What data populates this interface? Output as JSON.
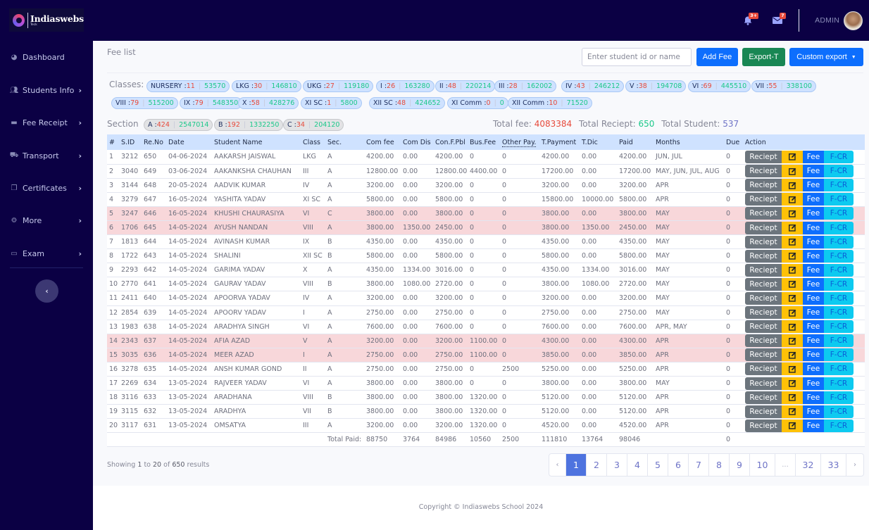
{
  "brand": {
    "name": "Indiaswebs",
    "tagline": "Teck"
  },
  "topbar": {
    "alerts_badge": "3+",
    "messages_badge": "7",
    "user_label": "ADMIN"
  },
  "sidebar": {
    "items": [
      {
        "label": "Dashboard",
        "icon": "gauge-icon",
        "has_children": false
      },
      {
        "label": "Students Info",
        "icon": "users-icon",
        "has_children": true
      },
      {
        "label": "Fee Receipt",
        "icon": "id-card-icon",
        "has_children": true
      },
      {
        "label": "Transport",
        "icon": "bus-icon",
        "has_children": true
      },
      {
        "label": "Certificates",
        "icon": "copy-icon",
        "has_children": true
      },
      {
        "label": "More",
        "icon": "gear-icon",
        "has_children": true
      },
      {
        "label": "Exam",
        "icon": "chalkboard-icon",
        "has_children": true
      }
    ]
  },
  "page": {
    "title": "Fee list",
    "search_placeholder": "Enter student id or name",
    "search_value": "",
    "buttons": {
      "add_fee": "Add Fee",
      "export_t": "Export-T",
      "custom_export": "Custom export"
    }
  },
  "classes": {
    "label": "Classes:",
    "items": [
      {
        "name": "NURSERY",
        "count": "11",
        "amount": "53570"
      },
      {
        "name": "LKG",
        "count": "30",
        "amount": "146810"
      },
      {
        "name": "UKG",
        "count": "27",
        "amount": "119180"
      },
      {
        "name": "I",
        "count": "26",
        "amount": "163280"
      },
      {
        "name": "II",
        "count": "48",
        "amount": "220214"
      },
      {
        "name": "III",
        "count": "28",
        "amount": "162002"
      },
      {
        "name": "IV",
        "count": "43",
        "amount": "246212"
      },
      {
        "name": "V",
        "count": "38",
        "amount": "194708"
      },
      {
        "name": "VI",
        "count": "69",
        "amount": "445510"
      },
      {
        "name": "VII",
        "count": "55",
        "amount": "338100"
      },
      {
        "name": "VIII",
        "count": "79",
        "amount": "515200"
      },
      {
        "name": "IX",
        "count": "79",
        "amount": "548350"
      },
      {
        "name": "X",
        "count": "58",
        "amount": "428276"
      },
      {
        "name": "XI SC",
        "count": "1",
        "amount": "5800"
      },
      {
        "name": "XII SC",
        "count": "48",
        "amount": "424652"
      },
      {
        "name": "XI Comm",
        "count": "0",
        "amount": "0"
      },
      {
        "name": "XII Comm",
        "count": "10",
        "amount": "71520"
      }
    ]
  },
  "sections": {
    "label": "Section",
    "items": [
      {
        "name": "A",
        "count": "424",
        "amount": "2547014"
      },
      {
        "name": "B",
        "count": "192",
        "amount": "1332250"
      },
      {
        "name": "C",
        "count": "34",
        "amount": "204120"
      }
    ]
  },
  "totals": {
    "fee_label": "Total fee:",
    "fee_value": "4083384",
    "receipt_label": "Total Reciept:",
    "receipt_value": "650",
    "student_label": "Total Student:",
    "student_value": "537"
  },
  "table": {
    "columns": [
      "#",
      "S.ID",
      "Re.No",
      "Date",
      "Student Name",
      "Class",
      "Sec.",
      "Com fee",
      "Com Dis",
      "Con.F.Pbl",
      "Bus.Fee",
      "Other Pay.",
      "T.Payment",
      "T.Dic",
      "Paid",
      "Months",
      "Due",
      "Action"
    ],
    "action_labels": {
      "receipt": "Reciept",
      "edit": "edit-icon",
      "fee": "Fee",
      "fcr": "F-CR"
    },
    "rows": [
      {
        "n": "1",
        "sid": "3212",
        "reno": "650",
        "date": "04-06-2024",
        "name": "AAKARSH JAISWAL",
        "cls": "LKG",
        "sec": "A",
        "comfee": "4200.00",
        "comdis": "0.00",
        "conf": "4200.00",
        "bus": "0",
        "other": "0",
        "tpay": "4200.00",
        "tdic": "0.00",
        "paid": "4200.00",
        "months": "JUN, JUL",
        "due": "0",
        "highlight": false
      },
      {
        "n": "2",
        "sid": "3040",
        "reno": "649",
        "date": "03-06-2024",
        "name": "AAKANKSHA CHAUHAN",
        "cls": "III",
        "sec": "A",
        "comfee": "12800.00",
        "comdis": "0.00",
        "conf": "12800.00",
        "bus": "4400.00",
        "other": "0",
        "tpay": "17200.00",
        "tdic": "0.00",
        "paid": "17200.00",
        "months": "MAY, JUN, JUL, AUG",
        "due": "0",
        "highlight": false
      },
      {
        "n": "3",
        "sid": "3144",
        "reno": "648",
        "date": "20-05-2024",
        "name": "AADVIK KUMAR",
        "cls": "IV",
        "sec": "A",
        "comfee": "3200.00",
        "comdis": "0.00",
        "conf": "3200.00",
        "bus": "0",
        "other": "0",
        "tpay": "3200.00",
        "tdic": "0.00",
        "paid": "3200.00",
        "months": "APR",
        "due": "0",
        "highlight": false
      },
      {
        "n": "4",
        "sid": "3279",
        "reno": "647",
        "date": "16-05-2024",
        "name": "YASHITA YADAV",
        "cls": "XI SC",
        "sec": "A",
        "comfee": "5800.00",
        "comdis": "0.00",
        "conf": "5800.00",
        "bus": "0",
        "other": "0",
        "tpay": "15800.00",
        "tdic": "10000.00",
        "paid": "5800.00",
        "months": "APR",
        "due": "0",
        "highlight": false
      },
      {
        "n": "5",
        "sid": "3247",
        "reno": "646",
        "date": "16-05-2024",
        "name": "KHUSHI CHAURASIYA",
        "cls": "VI",
        "sec": "C",
        "comfee": "3800.00",
        "comdis": "0.00",
        "conf": "3800.00",
        "bus": "0",
        "other": "0",
        "tpay": "3800.00",
        "tdic": "0.00",
        "paid": "3800.00",
        "months": "MAY",
        "due": "0",
        "highlight": true
      },
      {
        "n": "6",
        "sid": "1706",
        "reno": "645",
        "date": "14-05-2024",
        "name": "AYUSH NANDAN",
        "cls": "VIII",
        "sec": "A",
        "comfee": "3800.00",
        "comdis": "1350.00",
        "conf": "2450.00",
        "bus": "0",
        "other": "0",
        "tpay": "3800.00",
        "tdic": "1350.00",
        "paid": "2450.00",
        "months": "MAY",
        "due": "0",
        "highlight": true
      },
      {
        "n": "7",
        "sid": "1813",
        "reno": "644",
        "date": "14-05-2024",
        "name": "AVINASH KUMAR",
        "cls": "IX",
        "sec": "B",
        "comfee": "4350.00",
        "comdis": "0.00",
        "conf": "4350.00",
        "bus": "0",
        "other": "0",
        "tpay": "4350.00",
        "tdic": "0.00",
        "paid": "4350.00",
        "months": "MAY",
        "due": "0",
        "highlight": false
      },
      {
        "n": "8",
        "sid": "1722",
        "reno": "643",
        "date": "14-05-2024",
        "name": "SHALINI",
        "cls": "XII SC",
        "sec": "B",
        "comfee": "5800.00",
        "comdis": "0.00",
        "conf": "5800.00",
        "bus": "0",
        "other": "0",
        "tpay": "5800.00",
        "tdic": "0.00",
        "paid": "5800.00",
        "months": "MAY",
        "due": "0",
        "highlight": false
      },
      {
        "n": "9",
        "sid": "2293",
        "reno": "642",
        "date": "14-05-2024",
        "name": "GARIMA YADAV",
        "cls": "X",
        "sec": "A",
        "comfee": "4350.00",
        "comdis": "1334.00",
        "conf": "3016.00",
        "bus": "0",
        "other": "0",
        "tpay": "4350.00",
        "tdic": "1334.00",
        "paid": "3016.00",
        "months": "MAY",
        "due": "0",
        "highlight": false
      },
      {
        "n": "10",
        "sid": "2770",
        "reno": "641",
        "date": "14-05-2024",
        "name": "GAURAV YADAV",
        "cls": "VIII",
        "sec": "B",
        "comfee": "3800.00",
        "comdis": "1080.00",
        "conf": "2720.00",
        "bus": "0",
        "other": "0",
        "tpay": "3800.00",
        "tdic": "1080.00",
        "paid": "2720.00",
        "months": "MAY",
        "due": "0",
        "highlight": false
      },
      {
        "n": "11",
        "sid": "2411",
        "reno": "640",
        "date": "14-05-2024",
        "name": "APOORVA YADAV",
        "cls": "IV",
        "sec": "A",
        "comfee": "3200.00",
        "comdis": "0.00",
        "conf": "3200.00",
        "bus": "0",
        "other": "0",
        "tpay": "3200.00",
        "tdic": "0.00",
        "paid": "3200.00",
        "months": "MAY",
        "due": "0",
        "highlight": false
      },
      {
        "n": "12",
        "sid": "2854",
        "reno": "639",
        "date": "14-05-2024",
        "name": "APOORV YADAV",
        "cls": "I",
        "sec": "A",
        "comfee": "2750.00",
        "comdis": "0.00",
        "conf": "2750.00",
        "bus": "0",
        "other": "0",
        "tpay": "2750.00",
        "tdic": "0.00",
        "paid": "2750.00",
        "months": "MAY",
        "due": "0",
        "highlight": false
      },
      {
        "n": "13",
        "sid": "1983",
        "reno": "638",
        "date": "14-05-2024",
        "name": "ARADHYA SINGH",
        "cls": "VI",
        "sec": "A",
        "comfee": "7600.00",
        "comdis": "0.00",
        "conf": "7600.00",
        "bus": "0",
        "other": "0",
        "tpay": "7600.00",
        "tdic": "0.00",
        "paid": "7600.00",
        "months": "APR, MAY",
        "due": "0",
        "highlight": false
      },
      {
        "n": "14",
        "sid": "2343",
        "reno": "637",
        "date": "14-05-2024",
        "name": "AFIA AZAD",
        "cls": "V",
        "sec": "A",
        "comfee": "3200.00",
        "comdis": "0.00",
        "conf": "3200.00",
        "bus": "1100.00",
        "other": "0",
        "tpay": "4300.00",
        "tdic": "0.00",
        "paid": "4300.00",
        "months": "APR",
        "due": "0",
        "highlight": true
      },
      {
        "n": "15",
        "sid": "3035",
        "reno": "636",
        "date": "14-05-2024",
        "name": "MEER AZAD",
        "cls": "I",
        "sec": "A",
        "comfee": "2750.00",
        "comdis": "0.00",
        "conf": "2750.00",
        "bus": "1100.00",
        "other": "0",
        "tpay": "3850.00",
        "tdic": "0.00",
        "paid": "3850.00",
        "months": "APR",
        "due": "0",
        "highlight": true
      },
      {
        "n": "16",
        "sid": "3278",
        "reno": "635",
        "date": "14-05-2024",
        "name": "ANSH KUMAR GOND",
        "cls": "II",
        "sec": "A",
        "comfee": "2750.00",
        "comdis": "0.00",
        "conf": "2750.00",
        "bus": "0",
        "other": "2500",
        "tpay": "5250.00",
        "tdic": "0.00",
        "paid": "5250.00",
        "months": "APR",
        "due": "0",
        "highlight": false
      },
      {
        "n": "17",
        "sid": "2269",
        "reno": "634",
        "date": "13-05-2024",
        "name": "RAJVEER YADAV",
        "cls": "VI",
        "sec": "A",
        "comfee": "3800.00",
        "comdis": "0.00",
        "conf": "3800.00",
        "bus": "0",
        "other": "0",
        "tpay": "3800.00",
        "tdic": "0.00",
        "paid": "3800.00",
        "months": "MAY",
        "due": "0",
        "highlight": false
      },
      {
        "n": "18",
        "sid": "3116",
        "reno": "633",
        "date": "13-05-2024",
        "name": "ARADHANA",
        "cls": "VIII",
        "sec": "B",
        "comfee": "3800.00",
        "comdis": "0.00",
        "conf": "3800.00",
        "bus": "1320.00",
        "other": "0",
        "tpay": "5120.00",
        "tdic": "0.00",
        "paid": "5120.00",
        "months": "APR",
        "due": "0",
        "highlight": false
      },
      {
        "n": "19",
        "sid": "3115",
        "reno": "632",
        "date": "13-05-2024",
        "name": "ARADHYA",
        "cls": "VII",
        "sec": "B",
        "comfee": "3800.00",
        "comdis": "0.00",
        "conf": "3800.00",
        "bus": "1320.00",
        "other": "0",
        "tpay": "5120.00",
        "tdic": "0.00",
        "paid": "5120.00",
        "months": "APR",
        "due": "0",
        "highlight": false
      },
      {
        "n": "20",
        "sid": "3117",
        "reno": "631",
        "date": "13-05-2024",
        "name": "OMSATYA",
        "cls": "III",
        "sec": "A",
        "comfee": "3200.00",
        "comdis": "0.00",
        "conf": "3200.00",
        "bus": "1320.00",
        "other": "0",
        "tpay": "4520.00",
        "tdic": "0.00",
        "paid": "4520.00",
        "months": "APR",
        "due": "0",
        "highlight": false
      }
    ],
    "total_row": {
      "label": "Total Paid:",
      "comfee": "88750",
      "comdis": "3764",
      "conf": "84986",
      "bus": "10560",
      "other": "2500",
      "tpay": "111810",
      "tdic": "13764",
      "paid": "98046",
      "due": "0"
    }
  },
  "pagination": {
    "summary_prefix": "Showing",
    "from": "1",
    "to_word": "to",
    "to": "20",
    "of_word": "of",
    "total": "650",
    "suffix": "results",
    "prev": "‹",
    "next": "›",
    "pages": [
      "1",
      "2",
      "3",
      "4",
      "5",
      "6",
      "7",
      "8",
      "9",
      "10",
      "...",
      "32",
      "33"
    ],
    "active_page": "1"
  },
  "footer": {
    "copyright": "Copyright © Indiaswebs School 2024"
  },
  "colors": {
    "sidebar_bg": "#0b0044",
    "primary": "#0d6efd",
    "success": "#198754",
    "danger_row": "#f8d7da",
    "count_red": "#e74a3b",
    "amount_green": "#1cc88a"
  }
}
